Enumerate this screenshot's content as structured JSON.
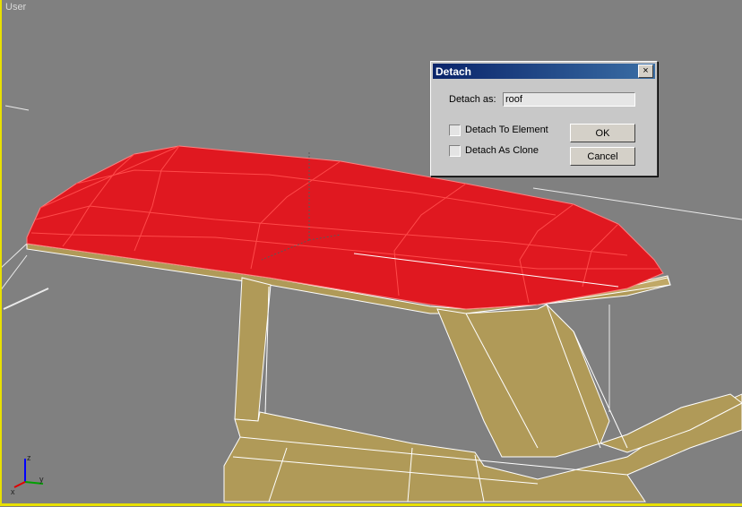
{
  "viewport": {
    "label": "User"
  },
  "dialog": {
    "title": "Detach",
    "close_glyph": "×",
    "detach_as_label": "Detach as:",
    "detach_as_value": "roof",
    "detach_to_element_label": "Detach To Element",
    "detach_as_clone_label": "Detach As Clone",
    "ok_label": "OK",
    "cancel_label": "Cancel"
  },
  "gizmo": {
    "x_label": "x",
    "y_label": "y",
    "z_label": "z"
  },
  "colors": {
    "selected_faces": "#e01820",
    "mesh_faces": "#b09a58",
    "viewport_bg": "#808080",
    "viewport_border": "#e8e000"
  }
}
